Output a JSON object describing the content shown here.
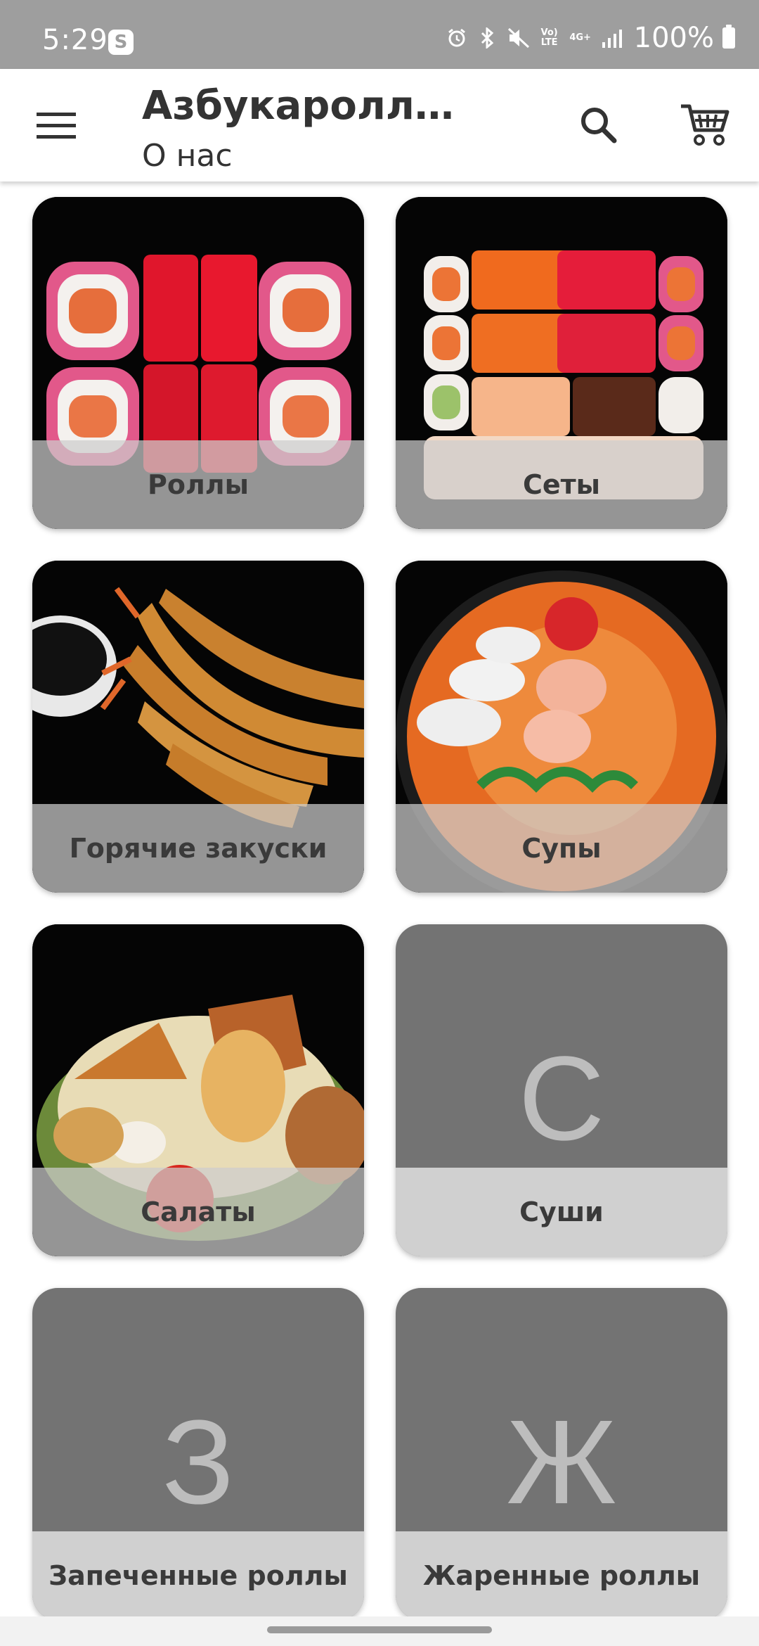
{
  "status_bar": {
    "time": "5:29",
    "app_icon_letter": "S",
    "network_label_top": "Vo)",
    "network_label_bottom": "LTE",
    "network_type": "4G+",
    "battery": "100%"
  },
  "app_bar": {
    "title": "Азбукароллов…",
    "subtitle": "О нас"
  },
  "categories": [
    {
      "label": "Роллы",
      "image": "rolls-photo"
    },
    {
      "label": "Сеты",
      "image": "sets-photo"
    },
    {
      "label": "Горячие закуски",
      "image": "hot-appetizers-photo"
    },
    {
      "label": "Супы",
      "image": "soups-photo"
    },
    {
      "label": "Салаты",
      "image": "salads-photo"
    },
    {
      "label": "Суши",
      "letter": "С"
    },
    {
      "label": "Запеченные роллы",
      "letter": "З"
    },
    {
      "label": "Жаренные роллы",
      "letter": "Ж"
    }
  ],
  "colors": {
    "status_bar": "#9e9e9e",
    "letter_tile": "#737373",
    "caption_overlay": "#cdcdcd",
    "text_dark": "#333333"
  }
}
